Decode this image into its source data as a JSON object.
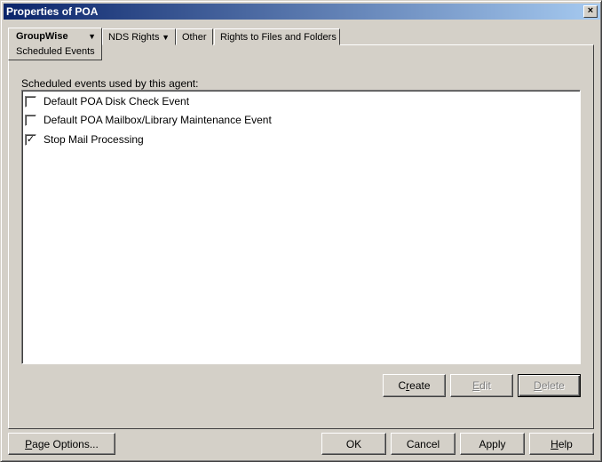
{
  "window": {
    "title": "Properties of POA",
    "close": "×"
  },
  "tabs": [
    {
      "label": "GroupWise",
      "arrow": "▼",
      "subtab": "Scheduled Events"
    },
    {
      "label": "NDS Rights",
      "arrow": "▼"
    },
    {
      "label": "Other"
    },
    {
      "label": "Rights to Files and Folders"
    }
  ],
  "panel": {
    "label": "Scheduled events used by this agent:",
    "events": [
      {
        "label": "Default POA Disk Check Event",
        "checked": false,
        "mark": ""
      },
      {
        "label": "Default POA Mailbox/Library Maintenance Event",
        "checked": false,
        "mark": ""
      },
      {
        "label": "Stop Mail Processing",
        "checked": true,
        "mark": "✓"
      }
    ],
    "create": {
      "pre": "C",
      "acc": "r",
      "post": "eate"
    },
    "edit": {
      "pre": "",
      "acc": "E",
      "post": "dit"
    },
    "delete": {
      "pre": "",
      "acc": "D",
      "post": "elete"
    }
  },
  "footer": {
    "page_options": {
      "pre": "",
      "acc": "P",
      "post": "age Options..."
    },
    "ok": "OK",
    "cancel": "Cancel",
    "apply": "Apply",
    "help": {
      "pre": "",
      "acc": "H",
      "post": "elp"
    }
  }
}
